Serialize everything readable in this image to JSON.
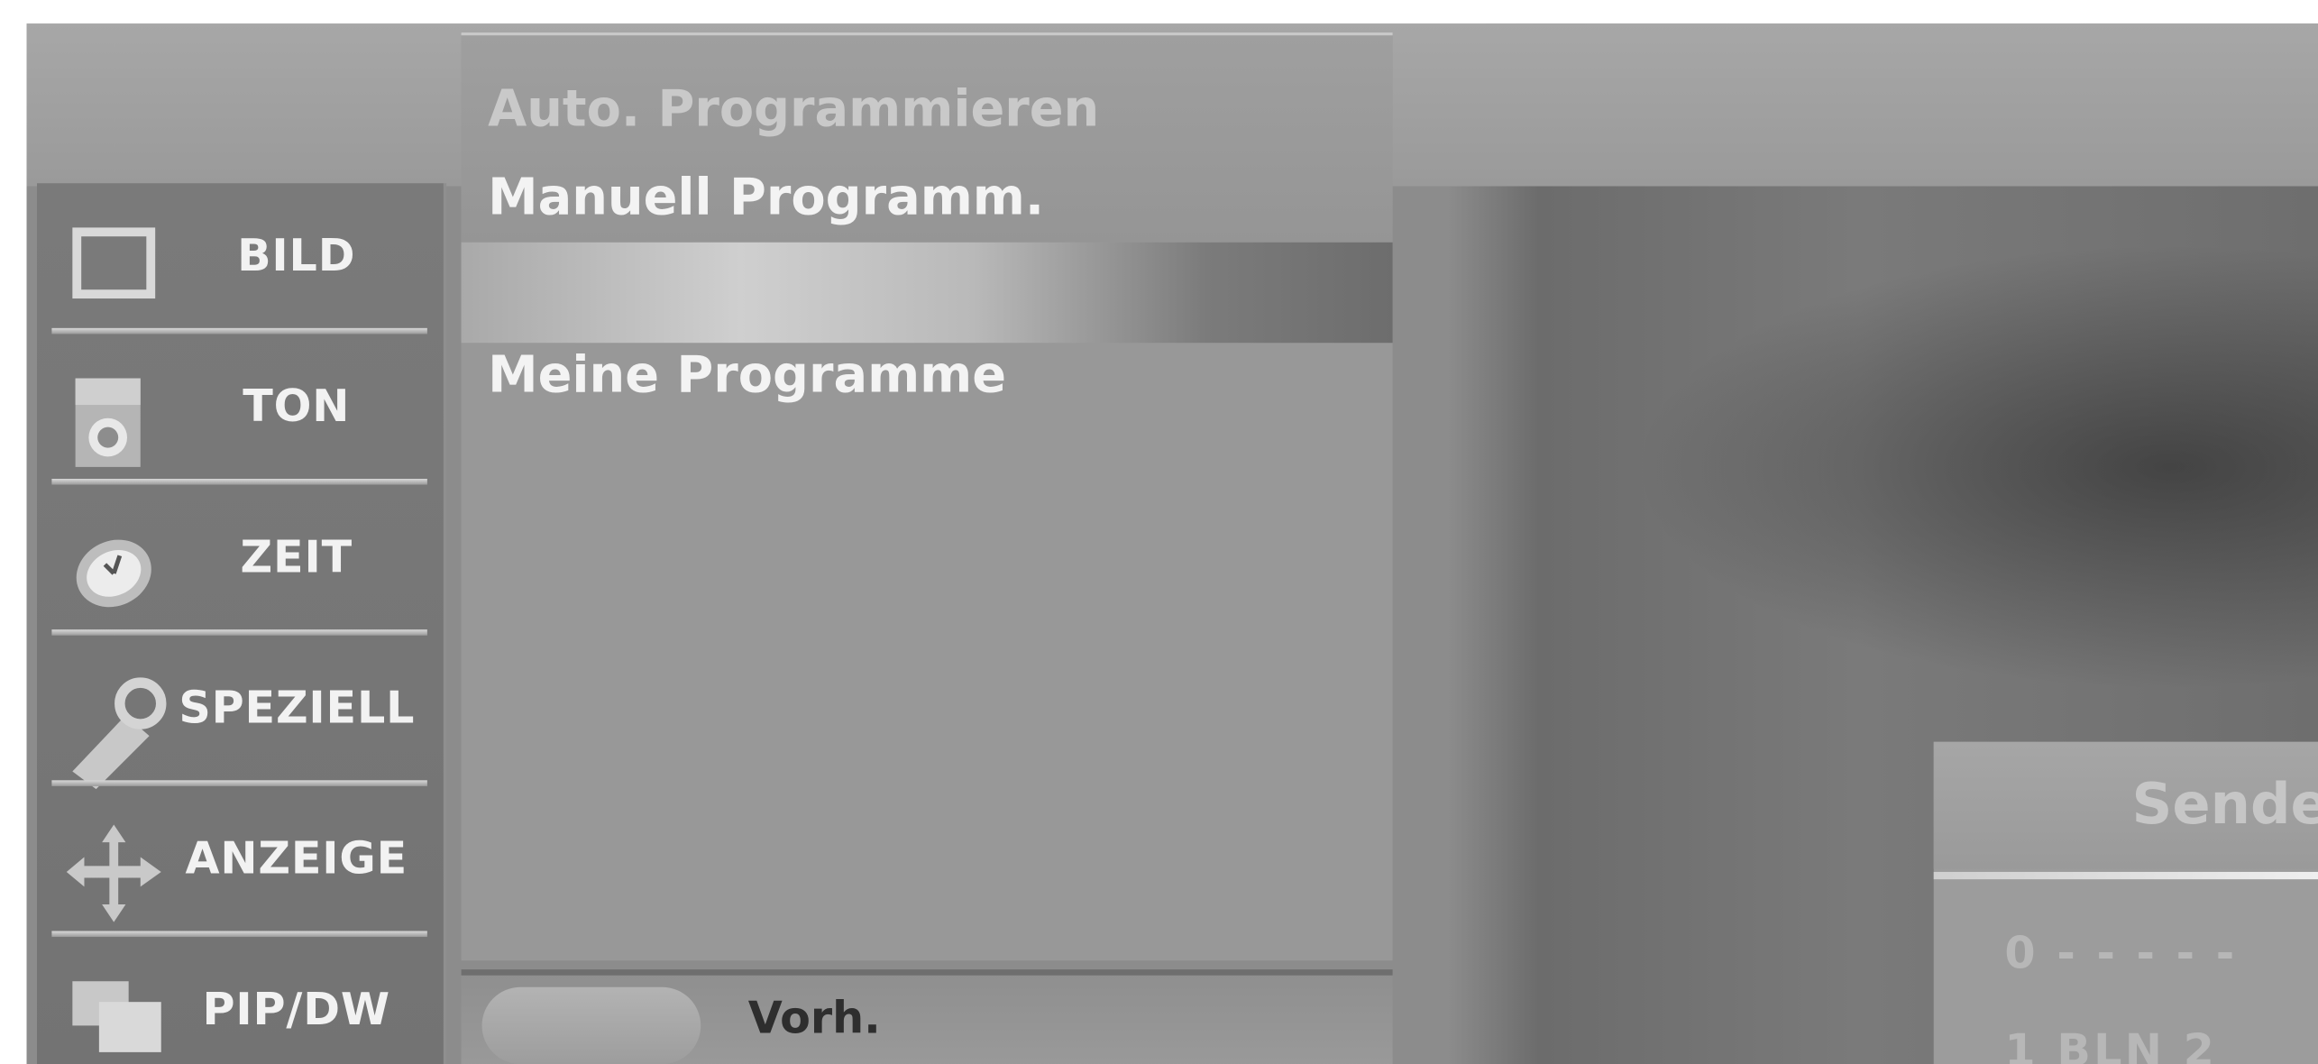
{
  "sidebar": {
    "items": [
      {
        "label": "BILD",
        "icon": "picture-icon"
      },
      {
        "label": "TON",
        "icon": "speaker-icon"
      },
      {
        "label": "ZEIT",
        "icon": "clock-icon"
      },
      {
        "label": "SPEZIELL",
        "icon": "key-icon"
      },
      {
        "label": "ANZEIGE",
        "icon": "move-arrows-icon"
      },
      {
        "label": "PIP/DW",
        "icon": "pip-icon"
      }
    ]
  },
  "menu": {
    "items": [
      {
        "label": "Auto. Programmieren"
      },
      {
        "label": "Manuell Programm."
      },
      {
        "label": ""
      },
      {
        "label": "Meine Programme"
      }
    ]
  },
  "footer": {
    "prev_label": "Vorh."
  },
  "sender_panel": {
    "title": "Sender",
    "rows": [
      "0 - - - - -",
      "1 BLN 2"
    ]
  }
}
